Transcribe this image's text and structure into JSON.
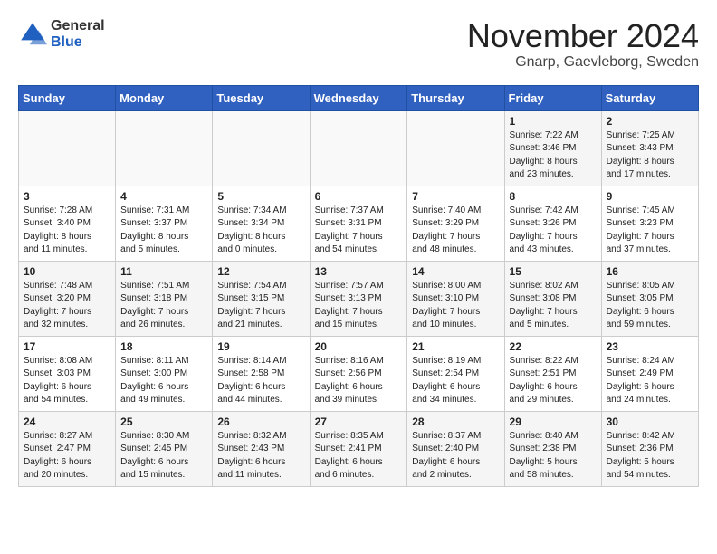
{
  "logo": {
    "general": "General",
    "blue": "Blue"
  },
  "title": "November 2024",
  "subtitle": "Gnarp, Gaevleborg, Sweden",
  "days_header": [
    "Sunday",
    "Monday",
    "Tuesday",
    "Wednesday",
    "Thursday",
    "Friday",
    "Saturday"
  ],
  "weeks": [
    [
      {
        "day": "",
        "info": ""
      },
      {
        "day": "",
        "info": ""
      },
      {
        "day": "",
        "info": ""
      },
      {
        "day": "",
        "info": ""
      },
      {
        "day": "",
        "info": ""
      },
      {
        "day": "1",
        "info": "Sunrise: 7:22 AM\nSunset: 3:46 PM\nDaylight: 8 hours\nand 23 minutes."
      },
      {
        "day": "2",
        "info": "Sunrise: 7:25 AM\nSunset: 3:43 PM\nDaylight: 8 hours\nand 17 minutes."
      }
    ],
    [
      {
        "day": "3",
        "info": "Sunrise: 7:28 AM\nSunset: 3:40 PM\nDaylight: 8 hours\nand 11 minutes."
      },
      {
        "day": "4",
        "info": "Sunrise: 7:31 AM\nSunset: 3:37 PM\nDaylight: 8 hours\nand 5 minutes."
      },
      {
        "day": "5",
        "info": "Sunrise: 7:34 AM\nSunset: 3:34 PM\nDaylight: 8 hours\nand 0 minutes."
      },
      {
        "day": "6",
        "info": "Sunrise: 7:37 AM\nSunset: 3:31 PM\nDaylight: 7 hours\nand 54 minutes."
      },
      {
        "day": "7",
        "info": "Sunrise: 7:40 AM\nSunset: 3:29 PM\nDaylight: 7 hours\nand 48 minutes."
      },
      {
        "day": "8",
        "info": "Sunrise: 7:42 AM\nSunset: 3:26 PM\nDaylight: 7 hours\nand 43 minutes."
      },
      {
        "day": "9",
        "info": "Sunrise: 7:45 AM\nSunset: 3:23 PM\nDaylight: 7 hours\nand 37 minutes."
      }
    ],
    [
      {
        "day": "10",
        "info": "Sunrise: 7:48 AM\nSunset: 3:20 PM\nDaylight: 7 hours\nand 32 minutes."
      },
      {
        "day": "11",
        "info": "Sunrise: 7:51 AM\nSunset: 3:18 PM\nDaylight: 7 hours\nand 26 minutes."
      },
      {
        "day": "12",
        "info": "Sunrise: 7:54 AM\nSunset: 3:15 PM\nDaylight: 7 hours\nand 21 minutes."
      },
      {
        "day": "13",
        "info": "Sunrise: 7:57 AM\nSunset: 3:13 PM\nDaylight: 7 hours\nand 15 minutes."
      },
      {
        "day": "14",
        "info": "Sunrise: 8:00 AM\nSunset: 3:10 PM\nDaylight: 7 hours\nand 10 minutes."
      },
      {
        "day": "15",
        "info": "Sunrise: 8:02 AM\nSunset: 3:08 PM\nDaylight: 7 hours\nand 5 minutes."
      },
      {
        "day": "16",
        "info": "Sunrise: 8:05 AM\nSunset: 3:05 PM\nDaylight: 6 hours\nand 59 minutes."
      }
    ],
    [
      {
        "day": "17",
        "info": "Sunrise: 8:08 AM\nSunset: 3:03 PM\nDaylight: 6 hours\nand 54 minutes."
      },
      {
        "day": "18",
        "info": "Sunrise: 8:11 AM\nSunset: 3:00 PM\nDaylight: 6 hours\nand 49 minutes."
      },
      {
        "day": "19",
        "info": "Sunrise: 8:14 AM\nSunset: 2:58 PM\nDaylight: 6 hours\nand 44 minutes."
      },
      {
        "day": "20",
        "info": "Sunrise: 8:16 AM\nSunset: 2:56 PM\nDaylight: 6 hours\nand 39 minutes."
      },
      {
        "day": "21",
        "info": "Sunrise: 8:19 AM\nSunset: 2:54 PM\nDaylight: 6 hours\nand 34 minutes."
      },
      {
        "day": "22",
        "info": "Sunrise: 8:22 AM\nSunset: 2:51 PM\nDaylight: 6 hours\nand 29 minutes."
      },
      {
        "day": "23",
        "info": "Sunrise: 8:24 AM\nSunset: 2:49 PM\nDaylight: 6 hours\nand 24 minutes."
      }
    ],
    [
      {
        "day": "24",
        "info": "Sunrise: 8:27 AM\nSunset: 2:47 PM\nDaylight: 6 hours\nand 20 minutes."
      },
      {
        "day": "25",
        "info": "Sunrise: 8:30 AM\nSunset: 2:45 PM\nDaylight: 6 hours\nand 15 minutes."
      },
      {
        "day": "26",
        "info": "Sunrise: 8:32 AM\nSunset: 2:43 PM\nDaylight: 6 hours\nand 11 minutes."
      },
      {
        "day": "27",
        "info": "Sunrise: 8:35 AM\nSunset: 2:41 PM\nDaylight: 6 hours\nand 6 minutes."
      },
      {
        "day": "28",
        "info": "Sunrise: 8:37 AM\nSunset: 2:40 PM\nDaylight: 6 hours\nand 2 minutes."
      },
      {
        "day": "29",
        "info": "Sunrise: 8:40 AM\nSunset: 2:38 PM\nDaylight: 5 hours\nand 58 minutes."
      },
      {
        "day": "30",
        "info": "Sunrise: 8:42 AM\nSunset: 2:36 PM\nDaylight: 5 hours\nand 54 minutes."
      }
    ]
  ]
}
